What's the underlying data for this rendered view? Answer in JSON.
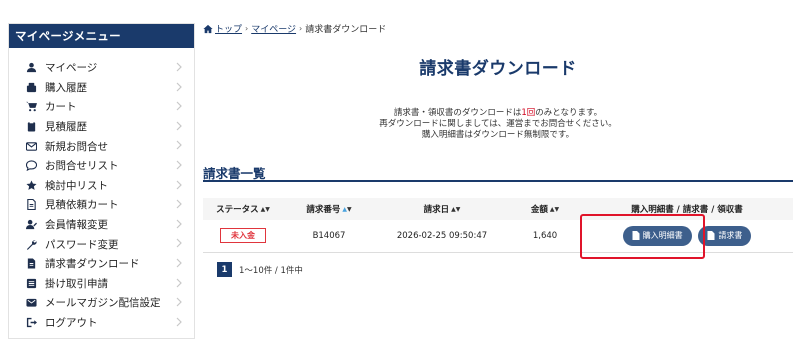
{
  "sidebar": {
    "title": "マイページメニュー",
    "items": [
      {
        "label": "マイページ",
        "icon": "user-icon"
      },
      {
        "label": "購入履歴",
        "icon": "purchase-icon"
      },
      {
        "label": "カート",
        "icon": "cart-icon"
      },
      {
        "label": "見積履歴",
        "icon": "clipboard-icon"
      },
      {
        "label": "新規お問合せ",
        "icon": "mail-icon"
      },
      {
        "label": "お問合せリスト",
        "icon": "chat-icon"
      },
      {
        "label": "検討中リスト",
        "icon": "star-icon"
      },
      {
        "label": "見積依頼カート",
        "icon": "document-icon"
      },
      {
        "label": "会員情報変更",
        "icon": "user-edit-icon"
      },
      {
        "label": "パスワード変更",
        "icon": "wrench-icon"
      },
      {
        "label": "請求書ダウンロード",
        "icon": "file-icon"
      },
      {
        "label": "掛け取引申請",
        "icon": "list-icon"
      },
      {
        "label": "メールマガジン配信設定",
        "icon": "mail-settings-icon"
      },
      {
        "label": "ログアウト",
        "icon": "logout-icon"
      }
    ]
  },
  "breadcrumb": {
    "home": "トップ",
    "mypage": "マイページ",
    "current": "請求書ダウンロード"
  },
  "page": {
    "title": "請求書ダウンロード",
    "notice_line1_pre": "請求書・領収書のダウンロードは",
    "notice_line1_red": "1回",
    "notice_line1_post": "のみとなります。",
    "notice_line2": "再ダウンロードに関しましては、運営までお問合せください。",
    "notice_line3": "購入明細書はダウンロード無制限です。",
    "section_title": "請求書一覧"
  },
  "table": {
    "headers": {
      "status": "ステータス",
      "number": "請求番号",
      "date": "請求日",
      "amount": "金額",
      "docs": "購入明細書 / 請求書 / 領収書"
    },
    "rows": [
      {
        "status": "未入金",
        "number": "B14067",
        "date": "2026-02-25 09:50:47",
        "amount": "1,640",
        "detail_button": "購入明細書",
        "invoice_button": "請求書"
      }
    ]
  },
  "pagination": {
    "current_page": "1",
    "info": "1〜10件 / 1件中"
  },
  "colors": {
    "brand_navy": "#1a3a6b",
    "button_blue": "#3d5f8c",
    "alert_red": "#e0353d",
    "highlight_red": "#e0142a"
  }
}
